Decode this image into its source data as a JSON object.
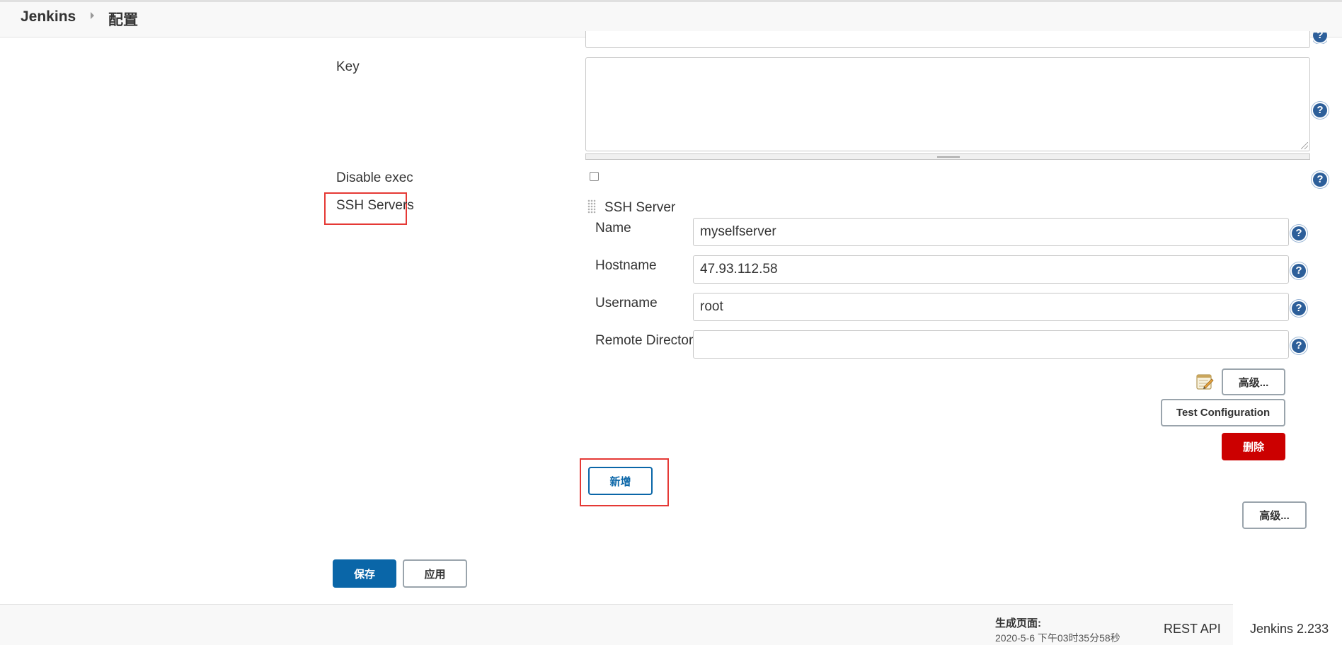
{
  "breadcrumb": {
    "home": "Jenkins",
    "current": "配置"
  },
  "form": {
    "key_label": "Key",
    "disable_exec_label": "Disable exec",
    "ssh_servers_label": "SSH Servers"
  },
  "ssh_server": {
    "header": "SSH Server",
    "name_label": "Name",
    "name_value": "myselfserver",
    "hostname_label": "Hostname",
    "hostname_value": "47.93.112.58",
    "username_label": "Username",
    "username_value": "root",
    "remote_dir_label": "Remote Directory",
    "remote_dir_value": "",
    "advanced_button": "高级...",
    "test_button": "Test Configuration",
    "delete_button": "删除"
  },
  "actions": {
    "add_button": "新增",
    "advanced_button": "高级...",
    "save_button": "保存",
    "apply_button": "应用"
  },
  "help_glyph": "?",
  "footer": {
    "generated_label": "生成页面:",
    "generated_time": "2020-5-6 下午03时35分58秒",
    "rest_api": "REST API",
    "version": "Jenkins 2.233"
  },
  "icons": {
    "notepad": "notepad-icon",
    "help": "help-icon",
    "drag": "drag-handle-icon"
  },
  "colors": {
    "primary": "#0a66a8",
    "danger": "#cc0000",
    "highlight": "#e53935",
    "help": "#2d5f9a"
  }
}
